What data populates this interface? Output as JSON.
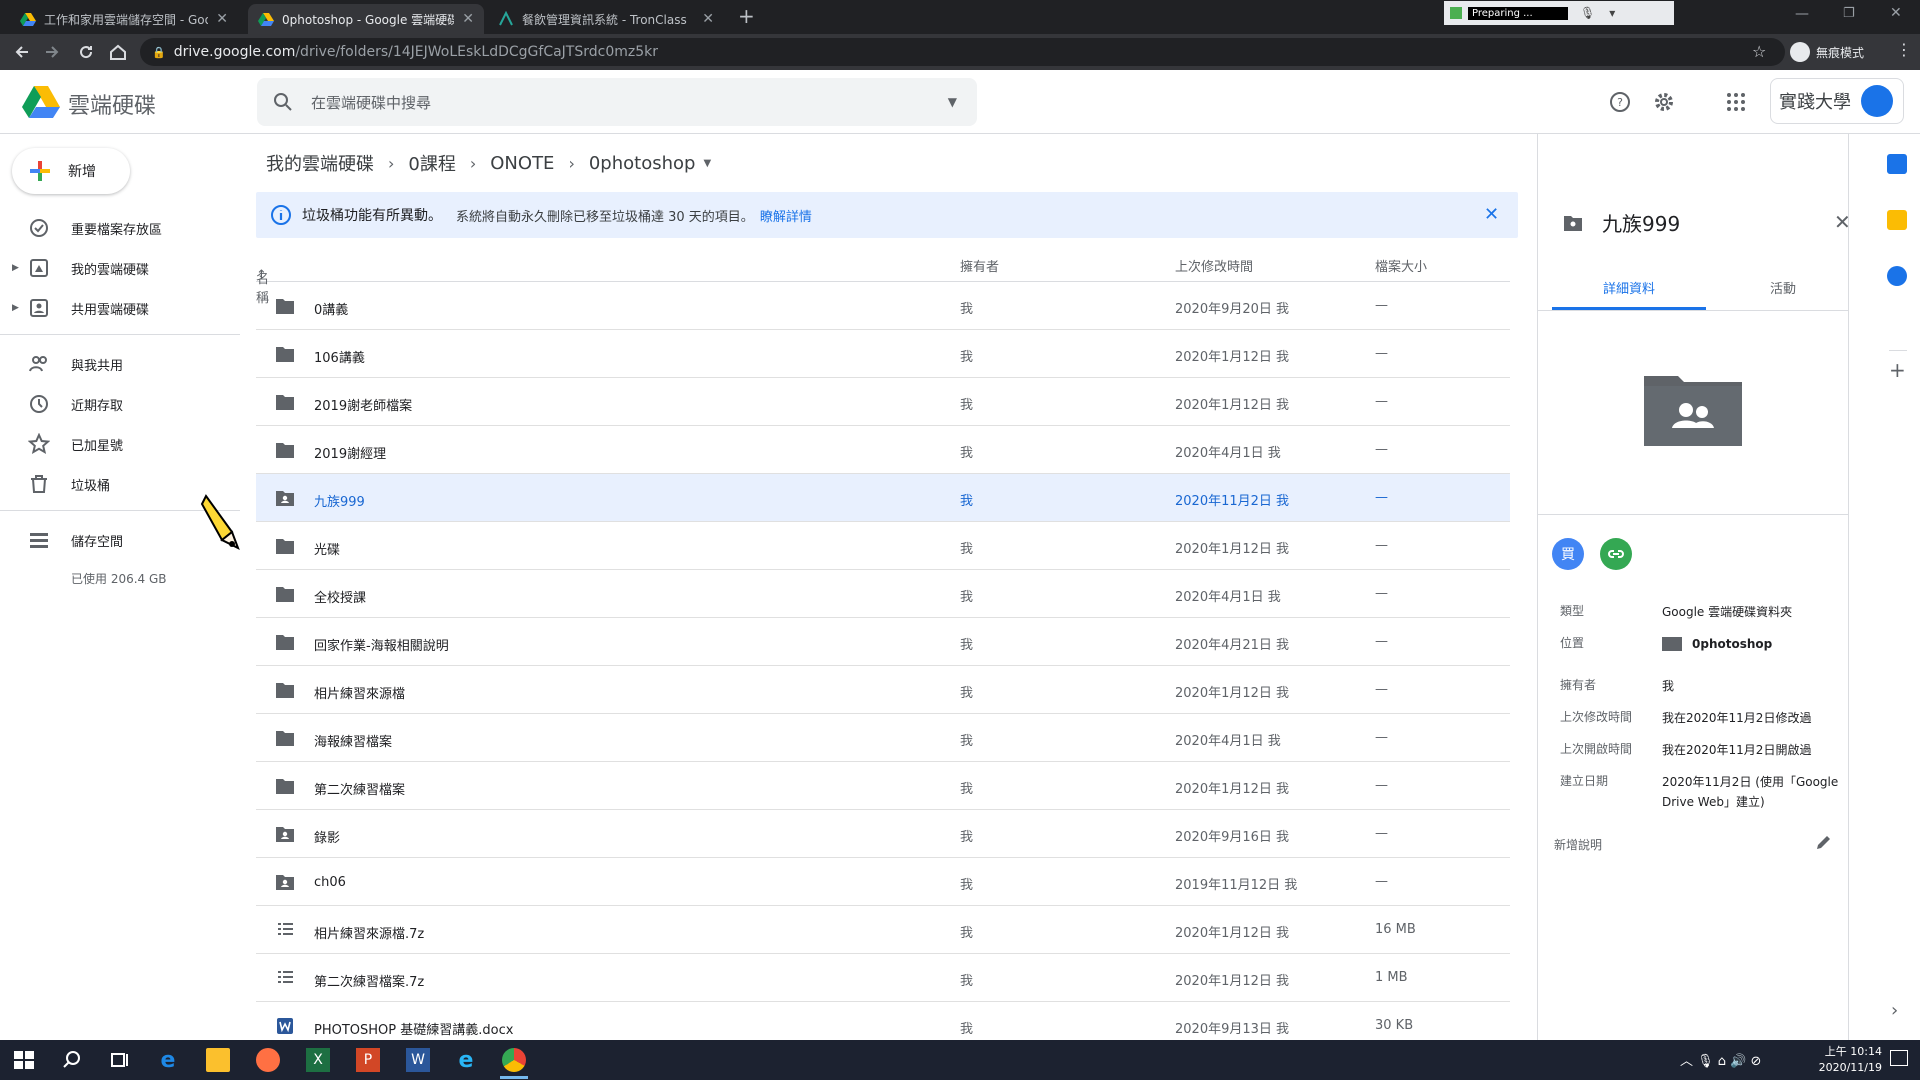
{
  "browser": {
    "tabs": [
      {
        "title": "工作和家用雲端儲存空間 - Goo",
        "active": false
      },
      {
        "title": "0photoshop - Google 雲端硬碟",
        "active": true
      },
      {
        "title": "餐飲管理資訊系統 - TronClass",
        "active": false
      }
    ],
    "new_tab": "+",
    "url_host": "drive.google.com",
    "url_path": "/drive/folders/14JEJWoLEskLdDCgGfCaJTSrdc0mz5kr",
    "incognito_label": "無痕模式",
    "overlay_text": "Preparing ..."
  },
  "header": {
    "product_name": "雲端硬碟",
    "search_placeholder": "在雲端硬碟中搜尋",
    "org_logo_text": "實踐大學"
  },
  "sidenav": {
    "new_label": "新增",
    "items": [
      {
        "label": "重要檔案存放區",
        "icon": "priority-icon"
      },
      {
        "label": "我的雲端硬碟",
        "icon": "my-drive-icon"
      },
      {
        "label": "共用雲端硬碟",
        "icon": "shared-drives-icon"
      },
      {
        "label": "與我共用",
        "icon": "shared-with-me-icon"
      },
      {
        "label": "近期存取",
        "icon": "recent-icon"
      },
      {
        "label": "已加星號",
        "icon": "star-icon"
      },
      {
        "label": "垃圾桶",
        "icon": "trash-icon"
      },
      {
        "label": "儲存空間",
        "icon": "storage-icon"
      }
    ],
    "storage_used": "已使用 206.4 GB"
  },
  "breadcrumb": [
    "我的雲端硬碟",
    "0課程",
    "ONOTE",
    "0photoshop"
  ],
  "banner": {
    "title": "垃圾桶功能有所異動。",
    "body": "系統將自動永久刪除已移至垃圾桶達 30 天的項目。",
    "link": "瞭解詳情"
  },
  "columns": {
    "name": "名稱",
    "owner": "擁有者",
    "modified": "上次修改時間",
    "size": "檔案大小"
  },
  "files": [
    {
      "name": "0講義",
      "owner": "我",
      "modified": "2020年9月20日 我",
      "size": "—",
      "type": "folder"
    },
    {
      "name": "106講義",
      "owner": "我",
      "modified": "2020年1月12日 我",
      "size": "—",
      "type": "folder"
    },
    {
      "name": "2019謝老師檔案",
      "owner": "我",
      "modified": "2020年1月12日 我",
      "size": "—",
      "type": "folder"
    },
    {
      "name": "2019謝經理",
      "owner": "我",
      "modified": "2020年4月1日 我",
      "size": "—",
      "type": "folder"
    },
    {
      "name": "九族999",
      "owner": "我",
      "modified": "2020年11月2日 我",
      "size": "—",
      "type": "shared-folder",
      "selected": true
    },
    {
      "name": "光碟",
      "owner": "我",
      "modified": "2020年1月12日 我",
      "size": "—",
      "type": "folder"
    },
    {
      "name": "全校授課",
      "owner": "我",
      "modified": "2020年4月1日 我",
      "size": "—",
      "type": "folder"
    },
    {
      "name": "回家作業-海報相關說明",
      "owner": "我",
      "modified": "2020年4月21日 我",
      "size": "—",
      "type": "folder"
    },
    {
      "name": "相片練習來源檔",
      "owner": "我",
      "modified": "2020年1月12日 我",
      "size": "—",
      "type": "folder"
    },
    {
      "name": "海報練習檔案",
      "owner": "我",
      "modified": "2020年4月1日 我",
      "size": "—",
      "type": "folder"
    },
    {
      "name": "第二次練習檔案",
      "owner": "我",
      "modified": "2020年1月12日 我",
      "size": "—",
      "type": "folder"
    },
    {
      "name": "錄影",
      "owner": "我",
      "modified": "2020年9月16日 我",
      "size": "—",
      "type": "shared-folder"
    },
    {
      "name": "ch06",
      "owner": "我",
      "modified": "2019年11月12日 我",
      "size": "—",
      "type": "shared-folder"
    },
    {
      "name": "相片練習來源檔.7z",
      "owner": "我",
      "modified": "2020年1月12日 我",
      "size": "16 MB",
      "type": "archive"
    },
    {
      "name": "第二次練習檔案.7z",
      "owner": "我",
      "modified": "2020年1月12日 我",
      "size": "1 MB",
      "type": "archive"
    },
    {
      "name": "PHOTOSHOP 基礎練習講義.docx",
      "owner": "我",
      "modified": "2020年9月13日 我",
      "size": "30 KB",
      "type": "word"
    }
  ],
  "details": {
    "title": "九族999",
    "tabs": [
      "詳細資料",
      "活動"
    ],
    "avatar_text": "買",
    "props": [
      {
        "key": "類型",
        "value": "Google 雲端硬碟資料夾"
      },
      {
        "key": "位置",
        "value": "0photoshop"
      },
      {
        "key": "擁有者",
        "value": "我"
      },
      {
        "key": "上次修改時間",
        "value": "我在2020年11月2日修改過"
      },
      {
        "key": "上次開啟時間",
        "value": "我在2020年11月2日開啟過"
      },
      {
        "key": "建立日期",
        "value": "2020年11月2日 (使用「Google Drive Web」建立)"
      }
    ],
    "add_description": "新增說明"
  },
  "taskbar": {
    "time": "上午 10:14",
    "date": "2020/11/19"
  },
  "colors": {
    "accent": "#1a73e8",
    "selected_row": "#e8f0fe",
    "chrome_dark": "#202124",
    "taskbar": "#1c2230"
  }
}
